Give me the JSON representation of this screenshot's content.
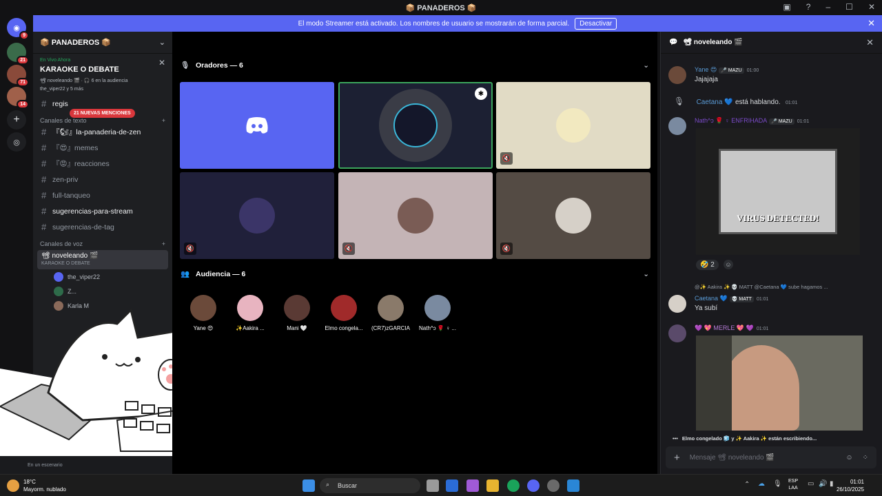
{
  "window": {
    "title": "📦 PANADEROS 📦"
  },
  "banner": {
    "text": "El modo Streamer está activado. Los nombres de usuario se mostrarán de forma parcial.",
    "button": "Desactivar"
  },
  "servers": {
    "badges": [
      "9",
      "21",
      "71",
      "14"
    ]
  },
  "server": {
    "name": "📦 PANADEROS 📦"
  },
  "live": {
    "label": "En Vivo Ahora",
    "title": "KARAOKE O DEBATE",
    "channel_info": "📽 noveleando 🎬 · 🎧 6 en la audiencia",
    "users": "the_viper22 y 5 más"
  },
  "mentions": "21 NUEVAS MENCIONES",
  "text_category": "Canales de texto",
  "channels": [
    {
      "name": "regis",
      "unread": true
    },
    {
      "name": "『🐿』la-panaderia-de-zen",
      "unread": true
    },
    {
      "name": "『😍』memes",
      "unread": false
    },
    {
      "name": "『😡』reacciones",
      "unread": false
    },
    {
      "name": "zen-priv",
      "unread": false
    },
    {
      "name": "full-tanqueo",
      "unread": false
    },
    {
      "name": "sugerencias-para-stream",
      "unread": true
    },
    {
      "name": "sugerencias-de-tag",
      "unread": false
    }
  ],
  "voice_category": "Canales de voz",
  "voice": {
    "name": "📽 noveleando 🎬",
    "topic": "KARAOKE O DEBATE",
    "users": [
      "the_viper22",
      "Z...",
      "Karla M"
    ]
  },
  "userpanel": {
    "status": "En un escenario"
  },
  "stage": {
    "speakers_title": "Oradores — 6",
    "audience_title": "Audiencia — 6"
  },
  "audience": [
    "Yane 😍",
    "✨Aakira ...",
    "Mani 🤍",
    "Elmo congela...",
    "(CR7)zGARCIA",
    "Nath^ↄ 🌹 ♀ ..."
  ],
  "chat": {
    "title": "📽 noveleando 🎬",
    "messages": [
      {
        "name": "Yane 😍",
        "tag": "🎤 MAZU",
        "time": "01:00",
        "text": "Jajajaja"
      },
      {
        "name": "Caetana 💙",
        "text": "está hablando.",
        "time": "01:01"
      },
      {
        "name": "Nath^ↄ 🌹 ♀ ENFRIHADA",
        "tag": "🎤 MAZU",
        "time": "01:01",
        "text": ""
      },
      {
        "name": "Caetana 💙",
        "tag": "💀 MATT",
        "time": "01:01",
        "text": "Ya subí"
      },
      {
        "name": "💜 💖 MERLE 💖 💜",
        "time": "01:01",
        "text": ""
      }
    ],
    "image_text": "VIRUS DETECTED!",
    "reaction": {
      "emoji": "🤣",
      "count": "2"
    },
    "reply": "@✨ Aakira ✨ 💀 MATT  @Caetana 💙  sube hagamos ...",
    "typing": "Elmo congelado 🧊 y ✨ Aakira ✨ están escribiendo...",
    "input_placeholder": "Mensaje 📽 noveleando 🎬"
  },
  "taskbar": {
    "temp": "18°C",
    "weather": "Mayorm. nublado",
    "search": "Buscar",
    "lang1": "ESP",
    "lang2": "LAA",
    "time": "01:01",
    "date": "26/10/2025"
  }
}
